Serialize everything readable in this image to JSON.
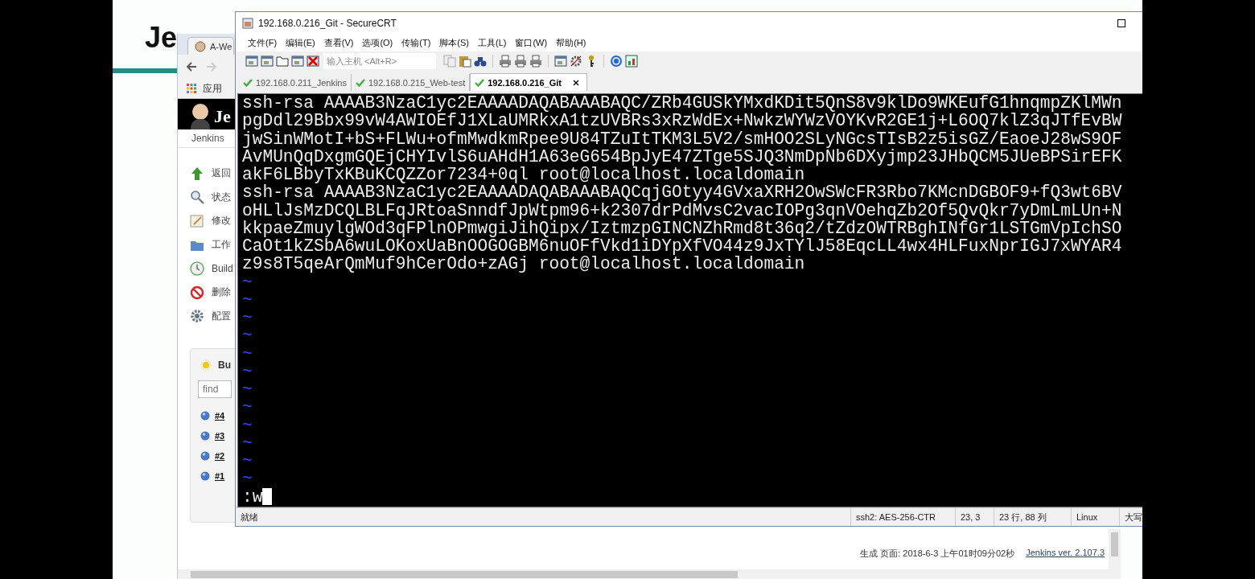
{
  "slide": {
    "title": "Je"
  },
  "browser": {
    "tab": {
      "label": "A-We"
    },
    "bookmarks": [
      {
        "label": "应用"
      }
    ],
    "header": {
      "logo_text": "Je"
    },
    "breadcrumb": "Jenkins",
    "sidebar": [
      {
        "kind": "up",
        "label": "返回"
      },
      {
        "kind": "search",
        "label": "状态"
      },
      {
        "kind": "edit",
        "label": "修改"
      },
      {
        "kind": "folder",
        "label": "工作"
      },
      {
        "kind": "clock",
        "label": "Build"
      },
      {
        "kind": "delete",
        "label": "删除"
      },
      {
        "kind": "gear",
        "label": "配置"
      }
    ],
    "build_history": {
      "title": "Bu",
      "search": {
        "placeholder": "find"
      },
      "builds": [
        "#4",
        "#3",
        "#2",
        "#1"
      ]
    },
    "footer": {
      "generated": "生成 页面: 2018-6-3 上午01时09分02秒",
      "version_link": "Jenkins ver. 2.107.3"
    }
  },
  "securecrt": {
    "title": "192.168.0.216_Git - SecureCRT",
    "menu": [
      "文件(F)",
      "编辑(E)",
      "查看(V)",
      "选项(O)",
      "传输(T)",
      "脚本(S)",
      "工具(L)",
      "窗口(W)",
      "帮助(H)"
    ],
    "host_field": {
      "placeholder": "输入主机 <Alt+R>"
    },
    "tabs": [
      {
        "label": "192.168.0.211_Jenkins",
        "selected": false
      },
      {
        "label": "192.168.0.215_Web-test",
        "selected": false
      },
      {
        "label": "192.168.0.216_Git",
        "selected": true
      }
    ],
    "terminal": {
      "lines": [
        "ssh-rsa AAAAB3NzaC1yc2EAAAADAQABAAABAQC/ZRb4GUSkYMxdKDit5QnS8v9klDo9WKEufG1hnqmpZKlMWn",
        "pgDdl29Bbx99vW4AWIOEfJ1XLaUMRkxA1tzUVBRs3xRzWdEx+NwkzWYWzVOYKvR2GE1j+L6OQ7klZ3qJTfEvBW",
        "jwSinWMotI+bS+FLWu+ofmMwdkmRpee9U84TZuItTKM3L5V2/smHOO2SLyNGcsTIsB2z5isGZ/EaoeJ28wS9OF",
        "AvMUnQqDxgmGQEjCHYIvlS6uAHdH1A63eG654BpJyE47ZTge5SJQ3NmDpNb6DXyjmp23JHbQCM5JUeBPSirEFK",
        "akF6LBbyTxKBuKCQZZor7234+0ql root@localhost.localdomain",
        "ssh-rsa AAAAB3NzaC1yc2EAAAADAQABAAABAQCqjGOtyy4GVxaXRH2OwSWcFR3Rbo7KMcnDGBOF9+fQ3wt6BV",
        "oHLlJsMzDCQLBLFqJRtoaSnndfJpWtpm96+k2307drPdMvsC2vacIOPg3qnVOehqZb2Of5QvQkr7yDmLmLUn+N",
        "kkpaeZmuylgWOd3qFPlnOPmwgiJihQipx/IztmzpGINCNZhRmd8t36q2/tZdzOWTRBghINfGr1LSTGmVpIchSO",
        "CaOt1kZSbA6wuLOKoxUaBnOOGOGBM6nuOFfVkd1iDYpXfVO44z9JxTYlJ58EqcLL4wx4HLFuxNprIGJ7xWYAR4",
        "z9s8T5qeArQmMuf9hCerOdo+zAGj root@localhost.localdomain"
      ],
      "empty_markers": [
        "~",
        "~",
        "~",
        "~",
        "~",
        "~",
        "~",
        "~",
        "~",
        "~",
        "~",
        "~"
      ],
      "command": ":w"
    },
    "status_bar": [
      "就绪",
      "ssh2: AES-256-CTR",
      "23,  3",
      "23 行, 88 列",
      "Linux",
      "大写"
    ]
  }
}
